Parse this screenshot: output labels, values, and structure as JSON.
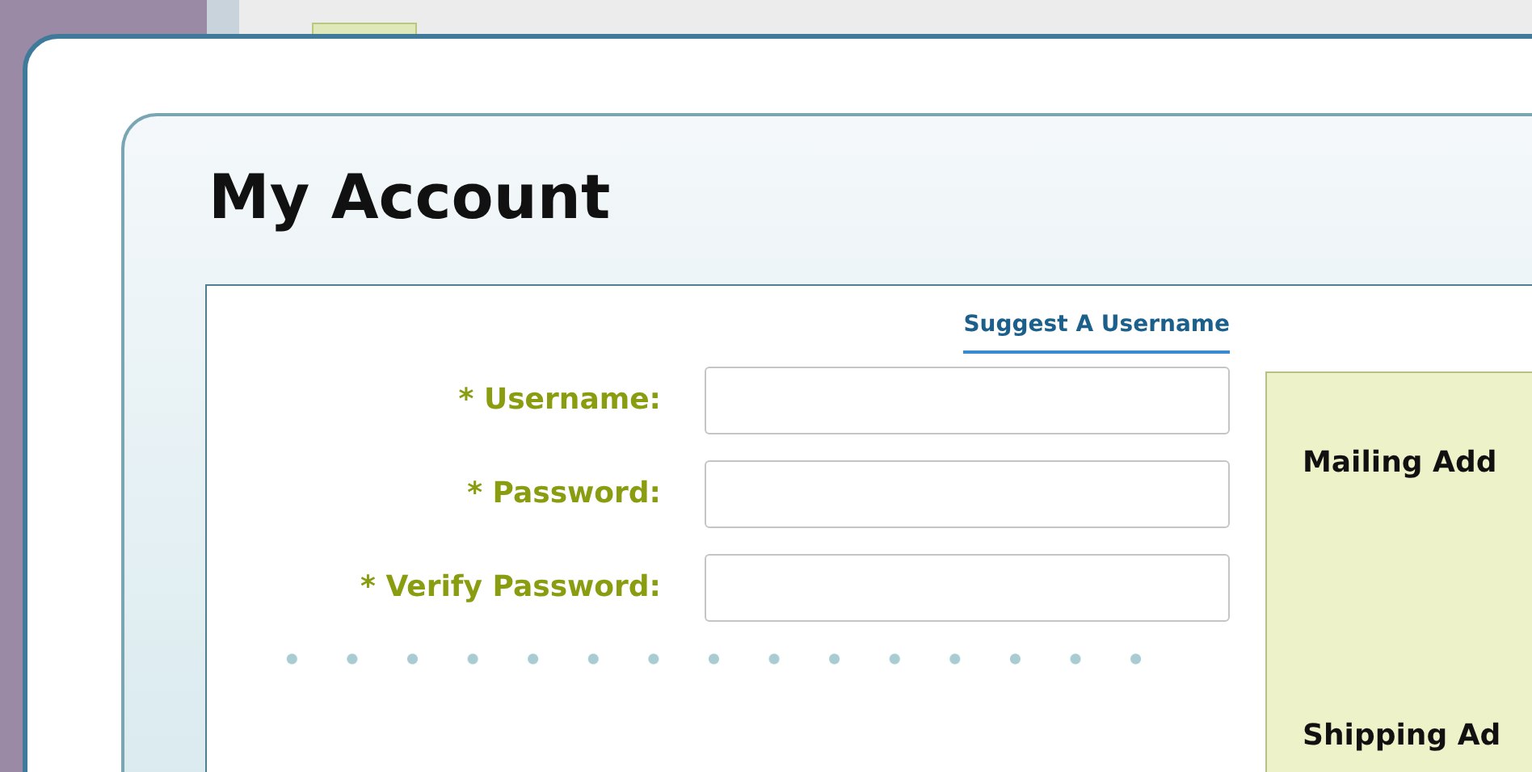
{
  "dialog": {
    "title": "My Account"
  },
  "form": {
    "suggest_link": "Suggest A Username",
    "fields": [
      {
        "label": "* Username:",
        "required": true
      },
      {
        "label": "* Password:",
        "required": true
      },
      {
        "label": "* Verify Password:",
        "required": true
      }
    ]
  },
  "address_panel": {
    "headings": [
      "Mailing Add",
      "Shipping Ad"
    ]
  }
}
